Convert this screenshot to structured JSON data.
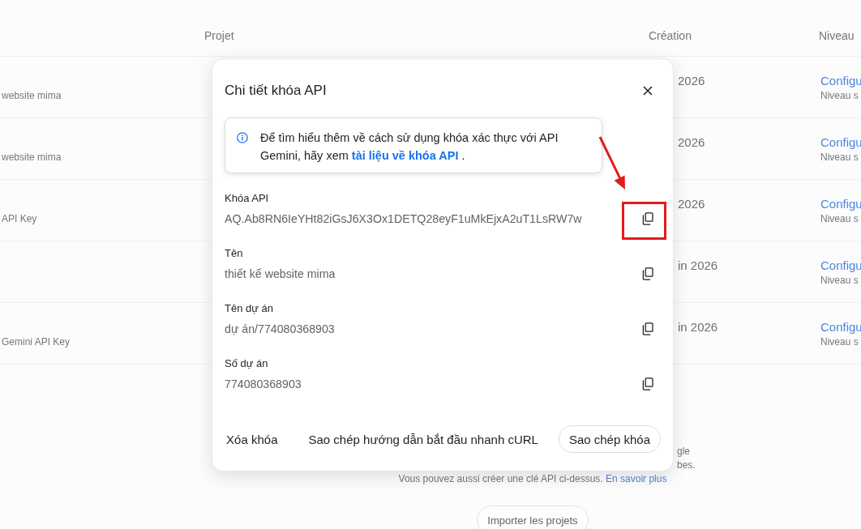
{
  "page": {
    "columns": [
      {
        "label": "Projet"
      },
      {
        "label": "Création"
      },
      {
        "label": "Niveau"
      }
    ],
    "rows": [
      {
        "subtitle": "website mima",
        "date": "2026",
        "action_link": "Configu",
        "tier": "Niveau s"
      },
      {
        "subtitle": "website mima",
        "date": "2026",
        "action_link": "Configu",
        "tier": "Niveau s"
      },
      {
        "subtitle": "API Key",
        "date": "2026",
        "action_link": "Configu",
        "tier": "Niveau s"
      },
      {
        "date": "in 2026",
        "action_link": "Configu",
        "tier": "Niveau s"
      },
      {
        "subtitle": "Gemini API Key",
        "date": "in 2026",
        "action_link": "Configu",
        "tier": "Niveau s"
      }
    ],
    "note_fragments": [
      "gle",
      "bes."
    ],
    "note": "Vous pouvez aussi créer une clé API ci-dessus.",
    "note_link": "En savoir plus",
    "import_button": "Importer les projets"
  },
  "dialog": {
    "title": "Chi tiết khóa API",
    "info": {
      "text_before": "Để tìm hiểu thêm về cách sử dụng khóa xác thực với API Gemini, hãy xem ",
      "link": "tài liệu về khóa API",
      "text_after": " ."
    },
    "fields": [
      {
        "label": "Khóa API",
        "value": "AQ.Ab8RN6IeYHt82iGsJ6X3Ox1DETQ28eyF1uMkEjxA2uT1LsRW7w",
        "highlighted": true
      },
      {
        "label": "Tên",
        "value": "thiết kế website mima",
        "highlighted": false
      },
      {
        "label": "Tên dự án",
        "value": "dự án/774080368903",
        "highlighted": false
      },
      {
        "label": "Số dự án",
        "value": "774080368903",
        "highlighted": false
      }
    ],
    "actions": [
      {
        "label": "Xóa khóa",
        "kind": "text"
      },
      {
        "label": "Sao chép hướng dẫn bắt đầu nhanh cURL",
        "kind": "text"
      },
      {
        "label": "Sao chép khóa",
        "kind": "outlined"
      }
    ]
  }
}
